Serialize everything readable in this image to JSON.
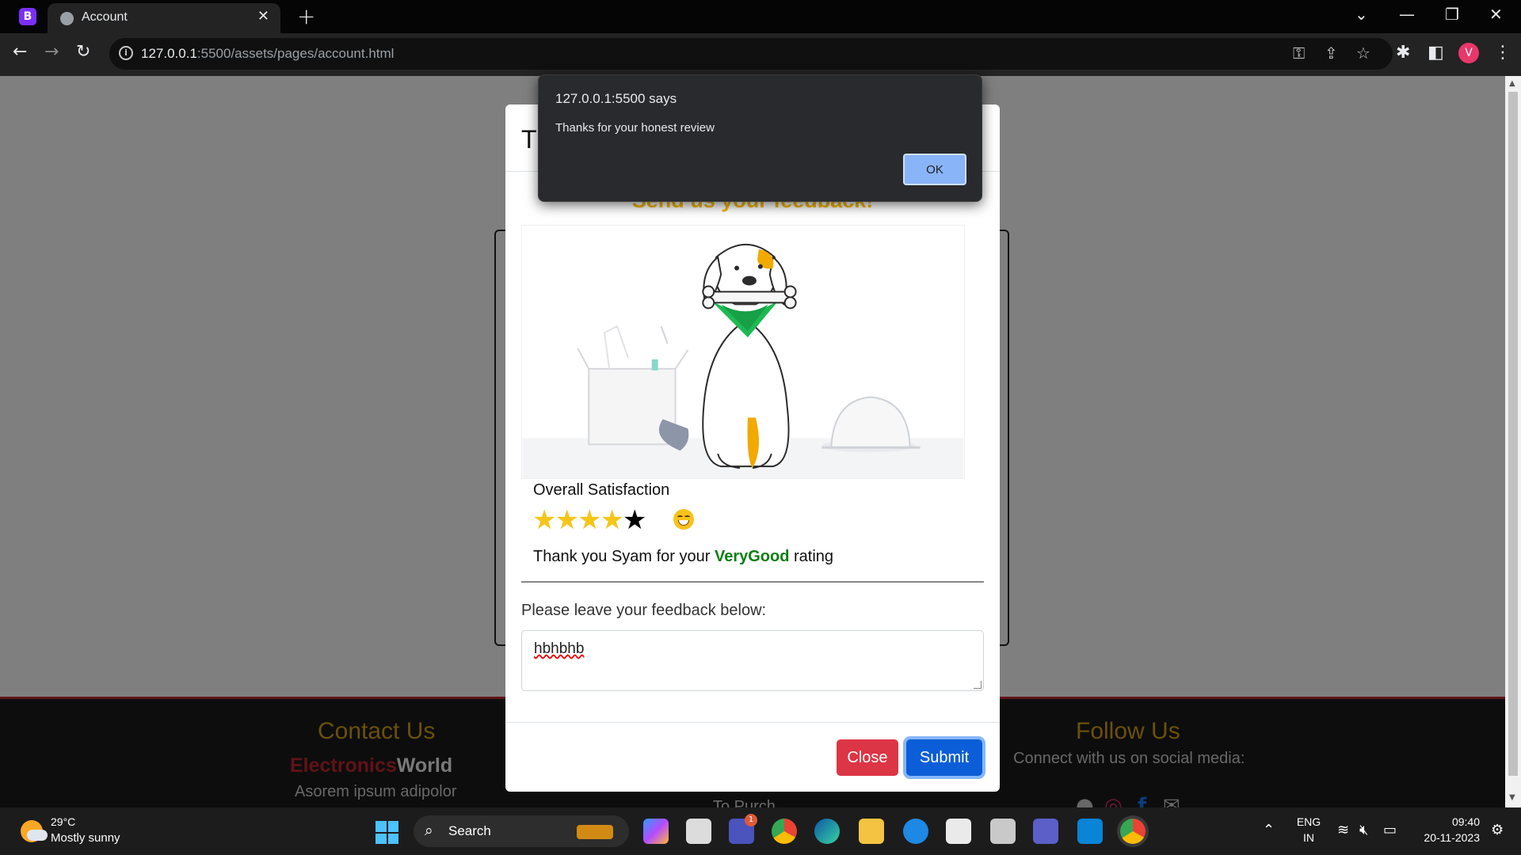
{
  "browser": {
    "app_badge": "B",
    "tab_title": "Account",
    "tab_close": "✕",
    "new_tab": "+",
    "url_host": "127.0.0.1",
    "url_rest": ":5500/assets/pages/account.html",
    "profile_initial": "V"
  },
  "page": {
    "modal": {
      "title": "Th",
      "heading": "Send us your feedback!",
      "satisfaction_label": "Overall Satisfaction",
      "stars_filled": 4,
      "stars_total": 5,
      "rating_prefix": "Thank you Syam for your ",
      "rating_word": "VeryGood",
      "rating_suffix": " rating",
      "feedback_label": "Please leave your feedback below:",
      "feedback_value": "hbhbhb",
      "close_label": "Close",
      "submit_label": "Submit"
    },
    "footer": {
      "contact_heading": "Contact Us",
      "brand_part1": "Electronics",
      "brand_part2": "World",
      "contact_text": "Asorem ipsum adipolor",
      "middle_partial": "To Purch",
      "follow_heading": "Follow Us",
      "follow_text": "Connect with us on social media:"
    }
  },
  "alert": {
    "origin": "127.0.0.1:5500 says",
    "message": "Thanks for your honest review",
    "ok_label": "OK"
  },
  "taskbar": {
    "weather_temp": "29°C",
    "weather_desc": "Mostly sunny",
    "search_label": "Search",
    "teams_badge": "1",
    "lang_line1": "ENG",
    "lang_line2": "IN",
    "time": "09:40",
    "date": "20-11-2023"
  },
  "colors": {
    "accent_yellow": "#f5b800",
    "rating_green": "#0a7f12",
    "close_red": "#dc3545",
    "submit_blue": "#0b5ed7",
    "star_gold": "#f5c518"
  }
}
